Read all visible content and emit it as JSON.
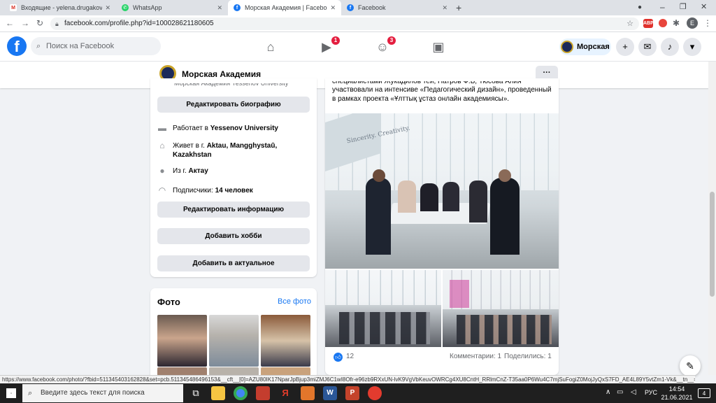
{
  "browser": {
    "tabs": [
      {
        "title": "Входящие - yelena.drugakova@...",
        "icon": "gmail-icon",
        "color": "#d93025",
        "active": false
      },
      {
        "title": "WhatsApp",
        "icon": "whatsapp-icon",
        "color": "#25d366",
        "active": false
      },
      {
        "title": "Морская Академия | Facebook",
        "icon": "facebook-icon",
        "color": "#1877f2",
        "active": true
      },
      {
        "title": "Facebook",
        "icon": "facebook-icon",
        "color": "#1877f2",
        "active": false
      }
    ],
    "url": "facebook.com/profile.php?id=100028621180605",
    "profile_letter": "E"
  },
  "fb": {
    "logo": "f",
    "search_placeholder": "Поиск на Facebook",
    "watch_badge": "1",
    "groups_badge": "3",
    "profile_chip": "Морская"
  },
  "profile": {
    "name": "Морская Академия",
    "more": "···"
  },
  "intro": {
    "cut_line": "Морская Академия Yessenov University",
    "edit_bio": "Редактировать биографию",
    "works_prefix": "Работает в ",
    "works_place": "Yessenov University",
    "lives_prefix": "Живет в г. ",
    "lives_place": "Aktau, Mangghystaū, Kazakhstan",
    "from_prefix": "Из г. ",
    "from_place": "Актау",
    "followers_prefix": "Подписчики: ",
    "followers_value": "14 человек",
    "edit_info": "Редактировать информацию",
    "add_hobby": "Добавить хобби",
    "add_featured": "Добавить в актуальное"
  },
  "photos": {
    "title": "Фото",
    "all_link": "Все фото"
  },
  "post": {
    "text_line1": "специалистами Жукадилов тей, Патров Ф.Б, Тюсова Алия",
    "text_line2": "участвовали на интенсиве «Педагогический дизайн», проведенный",
    "text_line3": "в рамках проекта «Ұлттық ұстаз онлайн академиясы».",
    "wall_text": "Sincerity. Creativity.",
    "likes": "12",
    "comments": "Комментарии: 1",
    "shares": "Поделились: 1"
  },
  "status_url": "https://www.facebook.com/photo/?fbid=511345403162828&set=pcb.511345486496153&__cft__[0]=AZU80IK17NparJpBjup3miZMJ6C1wI8Ofr-e96zb9RXxUN-lvK9VgVbKeuvOWRCg4XU8CntH_RRlmCnZ-T35aa0P6Wu4C7mjSuFogiZ0MojJyQxS7FD_AE4L89Y5vtZm1-Vk&__tn__=*bH-R",
  "taskbar": {
    "search_placeholder": "Введите здесь текст для поиска",
    "lang": "РУС",
    "time": "14:54",
    "date": "21.06.2021",
    "notifications": "4"
  }
}
